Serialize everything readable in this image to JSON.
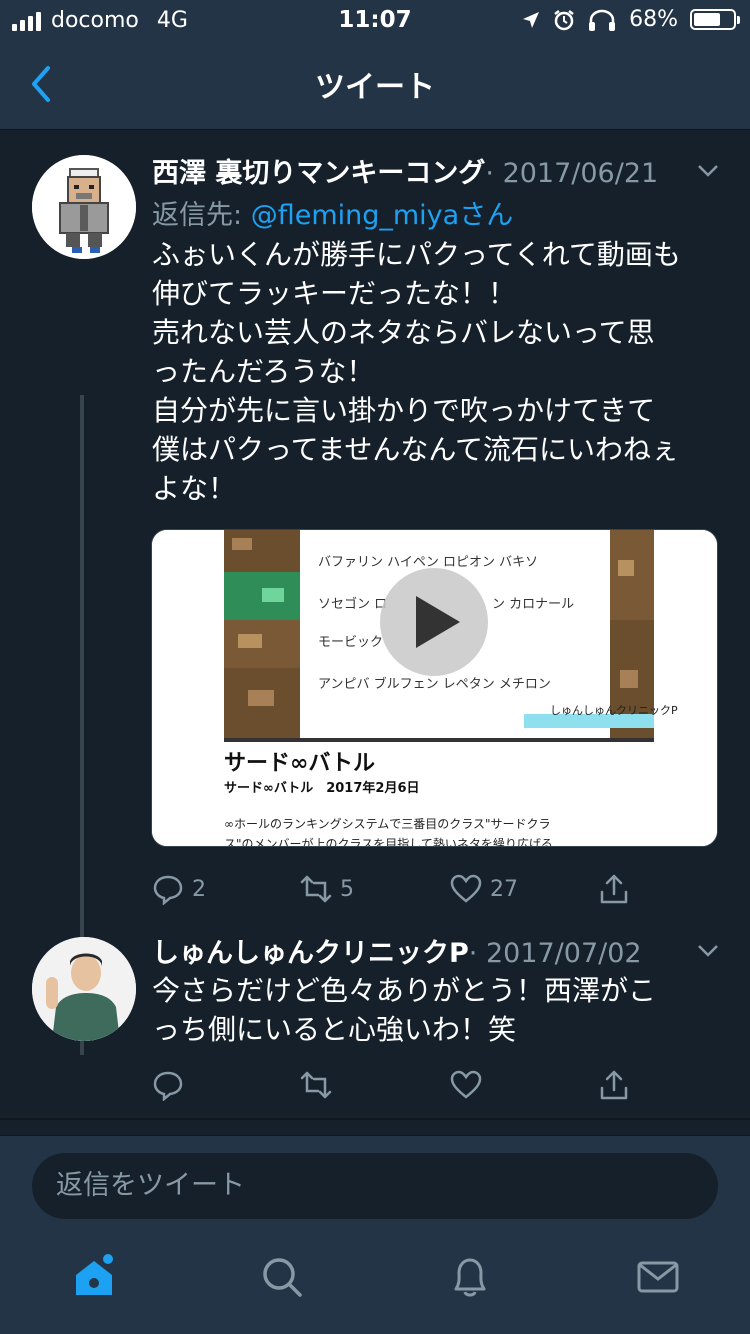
{
  "status_bar": {
    "carrier": "docomo",
    "network": "4G",
    "time": "11:07",
    "battery_percent": "68%",
    "battery_level": 0.68,
    "icons": [
      "location-arrow-icon",
      "alarm-icon",
      "headphones-icon",
      "battery-icon"
    ]
  },
  "nav": {
    "title": "ツイート",
    "back_icon": "chevron-left-icon"
  },
  "tweets": [
    {
      "display_name": "西澤 裏切りマンキーコング",
      "date": "· 2017/06/21",
      "reply_label": "返信先:",
      "reply_mention": "@fleming_miyaさん",
      "text": "ふぉいくんが勝手にパクってくれて動画も\n伸びてラッキーだったな！！\n売れない芸人のネタならバレないって思\nったんだろうな！\n自分が先に言い掛かりで吹っかけてきて\n僕はパクってませんなんて流石にいわねぇ\nよな！",
      "replies": "2",
      "retweets": "5",
      "likes": "27"
    },
    {
      "display_name": "しゅんしゅんクリニックP",
      "date": "· 2017/07/02",
      "text": "今さらだけど色々ありがとう！西澤がこ\nっち側にいると心強いわ！笑",
      "replies": "",
      "retweets": "",
      "likes": ""
    }
  ],
  "media_card": {
    "slide_lines": [
      "バファリン ハイペン ロピオン バキソ",
      "ソセゴン ロ",
      "ン カロナール",
      "モービック",
      "アンピバ ブルフェン レペタン メチロン"
    ],
    "watermark": "しゅんしゅんクリニックP",
    "title": "サード∞バトル",
    "subtitle": "サード∞バトル　2017年2月6日",
    "description_line1": "∞ホールのランキングシステムで三番目のクラス\"サードクラ",
    "description_line2": "ス\"のメンバーが上のクラスを目指して熱いネタを繰り広げる",
    "play_icon": "play-icon"
  },
  "reply_bar": {
    "placeholder": "返信をツイート"
  },
  "tab_bar": {
    "tabs": [
      "home-icon",
      "search-icon",
      "notifications-icon",
      "messages-icon"
    ]
  },
  "colors": {
    "background": "#15202b",
    "header": "#243447",
    "accent": "#1da1f2",
    "muted": "#8899a6"
  }
}
